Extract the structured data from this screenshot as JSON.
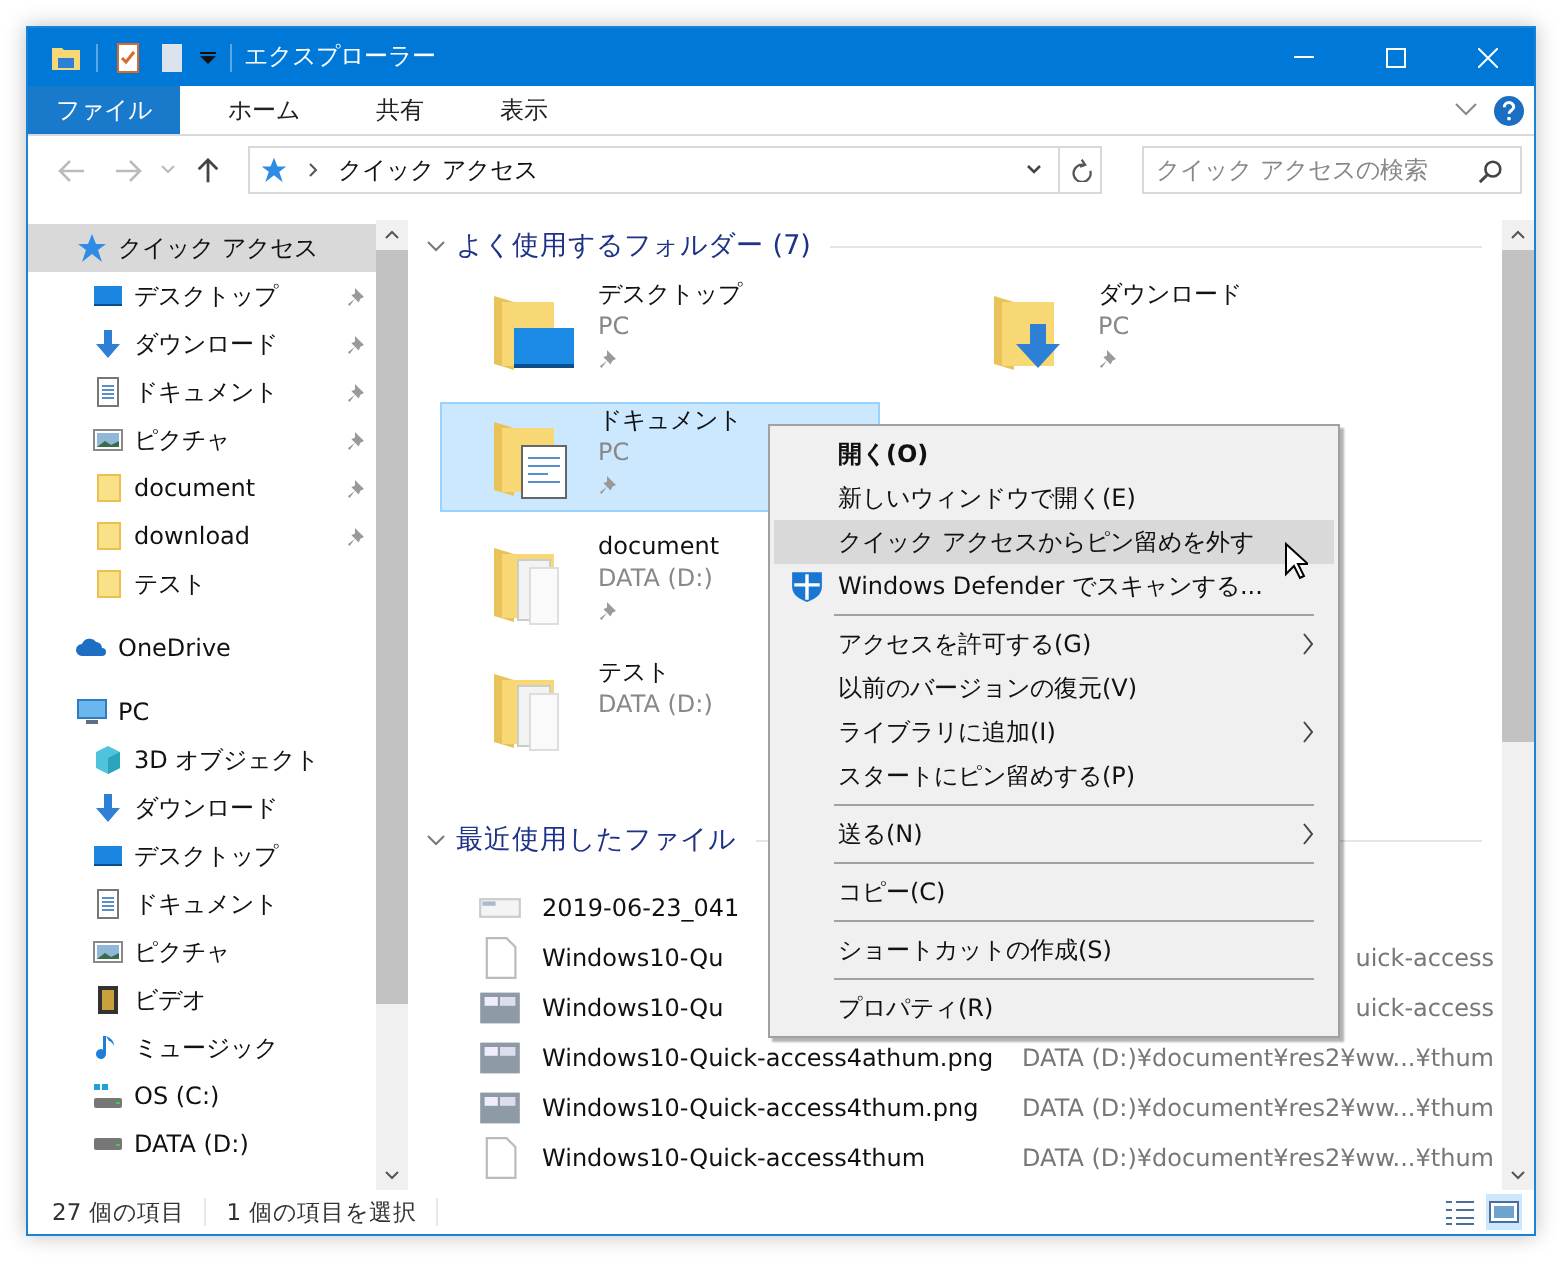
{
  "window": {
    "title": "エクスプローラー"
  },
  "ribbon_tabs": [
    {
      "label": "ファイル",
      "selected": true
    },
    {
      "label": "ホーム",
      "selected": false
    },
    {
      "label": "共有",
      "selected": false
    },
    {
      "label": "表示",
      "selected": false
    }
  ],
  "address_bar": {
    "path": "クイック アクセス"
  },
  "search": {
    "placeholder": "クイック アクセスの検索"
  },
  "sidebar": {
    "items": [
      {
        "label": "クイック アクセス",
        "kind": "star",
        "selected": true,
        "children": [
          {
            "label": "デスクトップ",
            "kind": "desktop",
            "pinned": true,
            "selected": false
          },
          {
            "label": "ダウンロード",
            "kind": "download",
            "pinned": true,
            "selected": false
          },
          {
            "label": "ドキュメント",
            "kind": "document",
            "pinned": true,
            "selected": false
          },
          {
            "label": "ピクチャ",
            "kind": "picture",
            "pinned": true,
            "selected": false
          },
          {
            "label": "document",
            "kind": "folder",
            "pinned": true,
            "selected": false
          },
          {
            "label": "download",
            "kind": "folder",
            "pinned": true,
            "selected": false
          },
          {
            "label": "テスト",
            "kind": "folder",
            "pinned": false,
            "selected": false
          }
        ]
      },
      {
        "label": "OneDrive",
        "kind": "cloud",
        "selected": false
      },
      {
        "label": "PC",
        "kind": "pc",
        "selected": false,
        "children": [
          {
            "label": "3D オブジェクト",
            "kind": "cube",
            "pinned": false,
            "selected": false
          },
          {
            "label": "ダウンロード",
            "kind": "download",
            "pinned": false,
            "selected": false
          },
          {
            "label": "デスクトップ",
            "kind": "desktop",
            "pinned": false,
            "selected": false
          },
          {
            "label": "ドキュメント",
            "kind": "document",
            "pinned": false,
            "selected": false
          },
          {
            "label": "ピクチャ",
            "kind": "picture",
            "pinned": false,
            "selected": false
          },
          {
            "label": "ビデオ",
            "kind": "video",
            "pinned": false,
            "selected": false
          },
          {
            "label": "ミュージック",
            "kind": "music",
            "pinned": false,
            "selected": false
          },
          {
            "label": "OS (C:)",
            "kind": "drive-os",
            "pinned": false,
            "selected": false
          },
          {
            "label": "DATA (D:)",
            "kind": "drive",
            "pinned": false,
            "selected": false
          }
        ]
      }
    ]
  },
  "frequent_folders": {
    "heading": "よく使用するフォルダー (7)",
    "items": [
      {
        "name": "デスクトップ",
        "location": "PC",
        "kind": "desktop",
        "pinned": true,
        "selected": false
      },
      {
        "name": "ダウンロード",
        "location": "PC",
        "kind": "download",
        "pinned": true,
        "selected": false
      },
      {
        "name": "ドキュメント",
        "location": "PC",
        "kind": "document",
        "pinned": true,
        "selected": true
      },
      {
        "name": "document",
        "location": "DATA (D:)",
        "kind": "pages",
        "pinned": true,
        "selected": false
      },
      {
        "name": "テスト",
        "location": "DATA (D:)",
        "kind": "pages",
        "pinned": false,
        "selected": false
      }
    ]
  },
  "recent_files": {
    "heading": "最近使用したファイル",
    "rows": [
      {
        "name": "2019-06-23_041",
        "kind": "screenshot-wide"
      },
      {
        "name": "Windows10-Qu",
        "path": "uick-access",
        "kind": "blank"
      },
      {
        "name": "Windows10-Qu",
        "path": "uick-access",
        "kind": "screenshot"
      },
      {
        "name": "Windows10-Quick-access4athum.png",
        "path": "DATA (D:)¥document¥res2¥ww...¥thum",
        "kind": "screenshot"
      },
      {
        "name": "Windows10-Quick-access4thum.png",
        "path": "DATA (D:)¥document¥res2¥ww...¥thum",
        "kind": "screenshot"
      },
      {
        "name": "Windows10-Quick-access4thum",
        "path": "DATA (D:)¥document¥res2¥ww...¥thum",
        "kind": "blank"
      }
    ]
  },
  "context_menu": {
    "items": [
      {
        "kind": "item",
        "label": "開く(O)",
        "default": true,
        "highlighted": false,
        "submenu": false
      },
      {
        "kind": "item",
        "label": "新しいウィンドウで開く(E)",
        "default": false,
        "highlighted": false,
        "submenu": false
      },
      {
        "kind": "item",
        "label": "クイック アクセスからピン留めを外す",
        "default": false,
        "highlighted": true,
        "submenu": false
      },
      {
        "kind": "shield-item",
        "label": "Windows Defender でスキャンする...",
        "default": false,
        "highlighted": false,
        "submenu": false
      },
      {
        "kind": "separator"
      },
      {
        "kind": "item",
        "label": "アクセスを許可する(G)",
        "default": false,
        "highlighted": false,
        "submenu": true
      },
      {
        "kind": "item",
        "label": "以前のバージョンの復元(V)",
        "default": false,
        "highlighted": false,
        "submenu": false
      },
      {
        "kind": "item",
        "label": "ライブラリに追加(I)",
        "default": false,
        "highlighted": false,
        "submenu": true
      },
      {
        "kind": "item",
        "label": "スタートにピン留めする(P)",
        "default": false,
        "highlighted": false,
        "submenu": false
      },
      {
        "kind": "separator"
      },
      {
        "kind": "item",
        "label": "送る(N)",
        "default": false,
        "highlighted": false,
        "submenu": true
      },
      {
        "kind": "separator"
      },
      {
        "kind": "item",
        "label": "コピー(C)",
        "default": false,
        "highlighted": false,
        "submenu": false
      },
      {
        "kind": "separator"
      },
      {
        "kind": "item",
        "label": "ショートカットの作成(S)",
        "default": false,
        "highlighted": false,
        "submenu": false
      },
      {
        "kind": "separator"
      },
      {
        "kind": "item",
        "label": "プロパティ(R)",
        "default": false,
        "highlighted": false,
        "submenu": false
      }
    ]
  },
  "status_bar": {
    "item_count": "27 個の項目",
    "selection": "1 個の項目を選択",
    "views": [
      {
        "kind": "details",
        "selected": false
      },
      {
        "kind": "large-icons",
        "selected": true
      }
    ]
  }
}
